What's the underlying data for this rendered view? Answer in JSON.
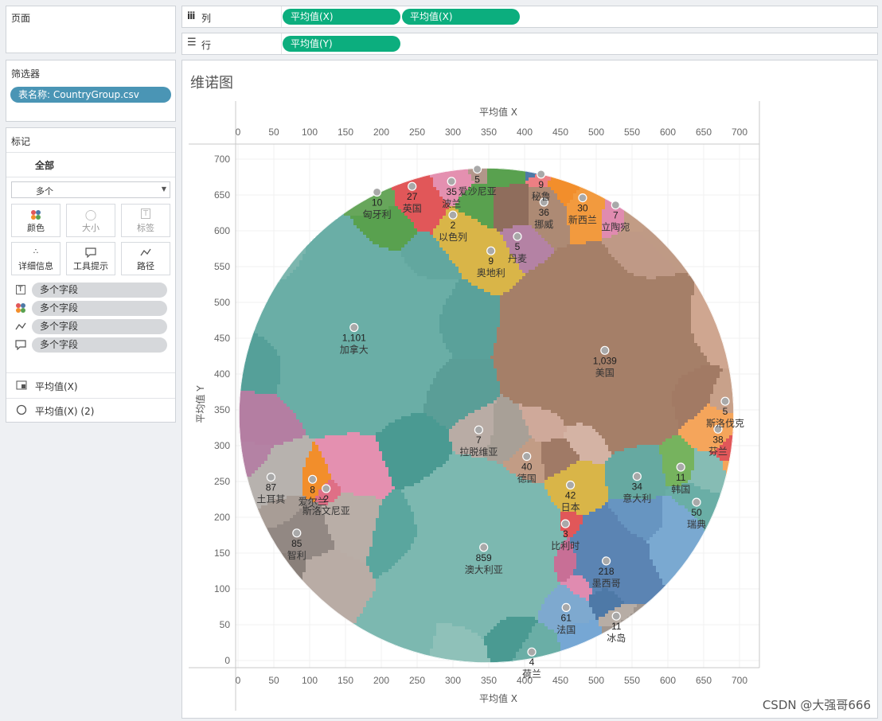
{
  "pages_panel": {
    "title": "页面"
  },
  "filters_panel": {
    "title": "筛选器",
    "pill": "表名称: CountryGroup.csv"
  },
  "marks_panel": {
    "title": "标记",
    "all_label": "全部",
    "type_select": "多个",
    "buttons": {
      "color": "颜色",
      "size": "大小",
      "label": "标签",
      "detail": "详细信息",
      "tooltip": "工具提示",
      "path": "路径"
    },
    "fields": [
      "多个字段",
      "多个字段",
      "多个字段",
      "多个字段"
    ],
    "measures": [
      "平均值(X)",
      "平均值(X) (2)"
    ]
  },
  "columns_shelf": {
    "label": "列",
    "pills": [
      "平均值(X)",
      "平均值(X)"
    ]
  },
  "rows_shelf": {
    "label": "行",
    "pills": [
      "平均值(Y)"
    ]
  },
  "view": {
    "title": "维诺图"
  },
  "colors": {
    "green_pill": "#0cae7e",
    "blue_pill": "#4a95b5"
  },
  "chart_data": {
    "type": "scatter",
    "title": "维诺图",
    "xlabel": "平均值 X",
    "ylabel": "平均值 Y",
    "xlim": [
      0,
      700
    ],
    "ylim": [
      0,
      700
    ],
    "xticks": [
      0,
      50,
      100,
      150,
      200,
      250,
      300,
      350,
      400,
      450,
      500,
      550,
      600,
      650,
      700
    ],
    "yticks": [
      0,
      50,
      100,
      150,
      200,
      250,
      300,
      350,
      400,
      450,
      500,
      550,
      600,
      650,
      700
    ],
    "grid": true,
    "points": [
      {
        "label": "加拿大",
        "value": "1,101",
        "x": 162,
        "y": 465,
        "color": "#6aaea6"
      },
      {
        "label": "美国",
        "value": "1,039",
        "x": 512,
        "y": 433,
        "color": "#a57f68"
      },
      {
        "label": "澳大利亚",
        "value": "859",
        "x": 343,
        "y": 158,
        "color": "#7cb8b0"
      },
      {
        "label": "墨西哥",
        "value": "218",
        "x": 514,
        "y": 139,
        "color": "#5b84b3"
      },
      {
        "label": "土耳其",
        "value": "87",
        "x": 46,
        "y": 256,
        "color": "#b7b2ae"
      },
      {
        "label": "智利",
        "value": "85",
        "x": 82,
        "y": 178,
        "color": "#928883"
      },
      {
        "label": "法国",
        "value": "61",
        "x": 458,
        "y": 74,
        "color": "#7ea9cf"
      },
      {
        "label": "瑞典",
        "value": "50",
        "x": 640,
        "y": 221,
        "color": "#6aaea6"
      },
      {
        "label": "日本",
        "value": "42",
        "x": 464,
        "y": 245,
        "color": "#d9b548"
      },
      {
        "label": "德国",
        "value": "40",
        "x": 403,
        "y": 285,
        "color": "#c29c85"
      },
      {
        "label": "芬兰",
        "value": "38",
        "x": 670,
        "y": 323,
        "color": "#f5a55b"
      },
      {
        "label": "挪威",
        "value": "36",
        "x": 427,
        "y": 640,
        "color": "#ad8a74"
      },
      {
        "label": "波兰",
        "value": "35",
        "x": 298,
        "y": 669,
        "color": "#e490b0"
      },
      {
        "label": "意大利",
        "value": "34",
        "x": 557,
        "y": 257,
        "color": "#66a9a1"
      },
      {
        "label": "新西兰",
        "value": "30",
        "x": 481,
        "y": 646,
        "color": "#f29a3e"
      },
      {
        "label": "英国",
        "value": "27",
        "x": 243,
        "y": 662,
        "color": "#e15759"
      },
      {
        "label": "韩国",
        "value": "11",
        "x": 618,
        "y": 270,
        "color": "#76b35e"
      },
      {
        "label": "冰岛",
        "value": "11",
        "x": 528,
        "y": 62,
        "color": "#b7ada5"
      },
      {
        "label": "匈牙利",
        "value": "10",
        "x": 194,
        "y": 654,
        "color": "#67a65b"
      },
      {
        "label": "秘鲁",
        "value": "9",
        "x": 423,
        "y": 679,
        "color": "#ed7f83"
      },
      {
        "label": "奥地利",
        "value": "9",
        "x": 353,
        "y": 572,
        "color": "#d9b548"
      },
      {
        "label": "斯洛伐克",
        "value": "5",
        "x": 680,
        "y": 362,
        "color": "#c8a18a"
      },
      {
        "label": "爱沙尼亚",
        "value": "5",
        "x": 334,
        "y": 686,
        "color": "#b2968a"
      },
      {
        "label": "丹麦",
        "value": "5",
        "x": 390,
        "y": 592,
        "color": "#b482a4"
      },
      {
        "label": "荷兰",
        "value": "4",
        "x": 410,
        "y": 12,
        "color": "#d0a935"
      },
      {
        "label": "爱尔兰",
        "value": "8",
        "x": 104,
        "y": 253,
        "color": "#f28e2b"
      },
      {
        "label": "拉脱维亚",
        "value": "7",
        "x": 336,
        "y": 322,
        "color": "#b9aca5"
      },
      {
        "label": "立陶宛",
        "value": "7",
        "x": 527,
        "y": 636,
        "color": "#e08bb0"
      },
      {
        "label": "比利时",
        "value": "3",
        "x": 457,
        "y": 191,
        "color": "#e15759"
      },
      {
        "label": "以色列",
        "value": "2",
        "x": 300,
        "y": 622,
        "color": "#d9b548"
      },
      {
        "label": "斯洛文尼亚",
        "value": "2",
        "x": 123,
        "y": 240,
        "color": "#df6f86"
      }
    ]
  },
  "watermark": "CSDN @大强哥666"
}
